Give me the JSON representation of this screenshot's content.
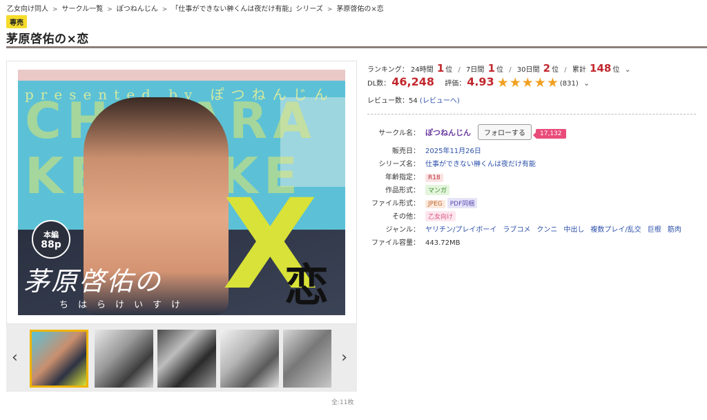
{
  "breadcrumb": [
    "乙女向け同人",
    "サークル一覧",
    "ぽつねんじん",
    "「仕事ができない榊くんは夜だけ有能」シリーズ",
    "茅原啓佑の×恋"
  ],
  "badge": "専売",
  "title": "茅原啓佑の×恋",
  "cover": {
    "presented": "presented by ぽつねんじん",
    "roman": "CHIHARA KEISUKE",
    "name": "茅原啓佑の",
    "x": "X",
    "koi": "恋",
    "ruby": "ちはらけいすけ",
    "pages_line1": "本編",
    "pages_line2": "88p"
  },
  "thumbnails": {
    "count_text": "全:11枚",
    "prev": "‹",
    "next": "›"
  },
  "ranking": {
    "label": "ランキング：",
    "h24_label": "24時間",
    "h24": "1",
    "unit": "位",
    "d7_label": "7日間",
    "d7": "1",
    "d30_label": "30日間",
    "d30": "2",
    "total_label": "累計",
    "total": "148"
  },
  "stats": {
    "dl_label": "DL数：",
    "dl": "46,248",
    "rating_label": "評価：",
    "rating": "4.93",
    "stars": "★★★★★",
    "rating_count": "(831)"
  },
  "review": {
    "label": "レビュー数：",
    "count": "54",
    "link": "(レビューへ)"
  },
  "spec": {
    "circle_label": "サークル名：",
    "circle": "ぽつねんじん",
    "follow": "フォローする",
    "followers": "17,132",
    "release_label": "販売日：",
    "release": "2025年11月26日",
    "series_label": "シリーズ名：",
    "series": "仕事ができない榊くんは夜だけ有能",
    "age_label": "年齢指定：",
    "age": "R18",
    "format_label": "作品形式：",
    "format": "マンガ",
    "file_label": "ファイル形式：",
    "file1": "JPEG",
    "file2": "PDF同梱",
    "other_label": "その他：",
    "other": "乙女向け",
    "genre_label": "ジャンル：",
    "genres": [
      "ヤリチン/プレイボーイ",
      "ラブコメ",
      "クンニ",
      "中出し",
      "複数プレイ/乱交",
      "巨根",
      "筋肉"
    ],
    "size_label": "ファイル容量：",
    "size": "443.72MB"
  },
  "colors": {
    "accent_red": "#c1272d",
    "link_blue": "#2a4fa8",
    "star": "#f0a020",
    "badge_yellow": "#f5dc2b"
  }
}
